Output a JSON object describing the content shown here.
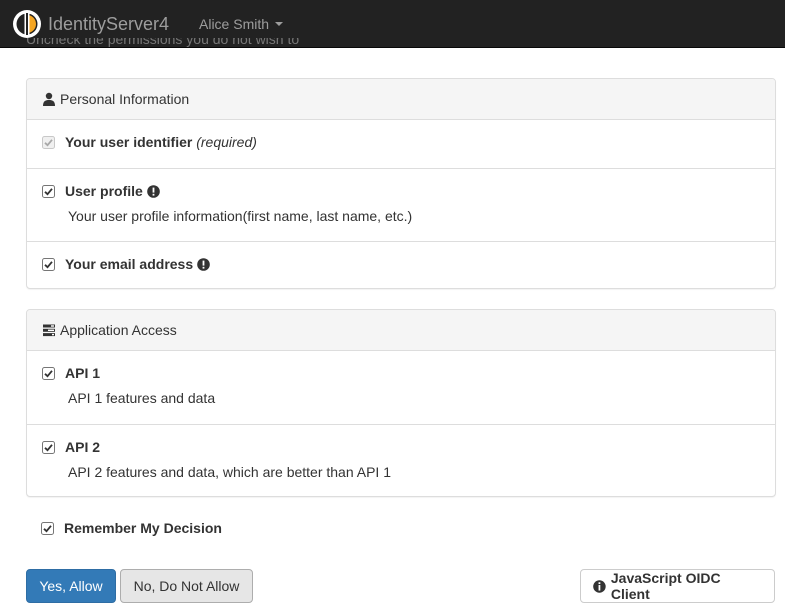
{
  "navbar": {
    "brand": "IdentityServer4",
    "user": "Alice Smith"
  },
  "intro_fragment": "Uncheck the permissions you do not wish to grant.",
  "personal_info": {
    "heading": "Personal Information",
    "scopes": [
      {
        "label": "Your user identifier",
        "required": "(required)",
        "checked": true,
        "disabled": true
      },
      {
        "label": "User profile",
        "description": "Your user profile information(first name, last name, etc.)",
        "checked": true
      },
      {
        "label": "Your email address",
        "checked": true
      }
    ]
  },
  "app_access": {
    "heading": "Application Access",
    "scopes": [
      {
        "label": "API 1",
        "description": "API 1 features and data",
        "checked": true
      },
      {
        "label": "API 2",
        "description": "API 2 features and data, which are better than API 1",
        "checked": true
      }
    ]
  },
  "remember": {
    "label": "Remember My Decision",
    "checked": true
  },
  "buttons": {
    "allow": "Yes, Allow",
    "deny": "No, Do Not Allow",
    "client": "JavaScript OIDC Client"
  },
  "colors": {
    "navbar_bg": "#222222",
    "primary": "#337ab7",
    "logo_accent": "#f5a623"
  }
}
